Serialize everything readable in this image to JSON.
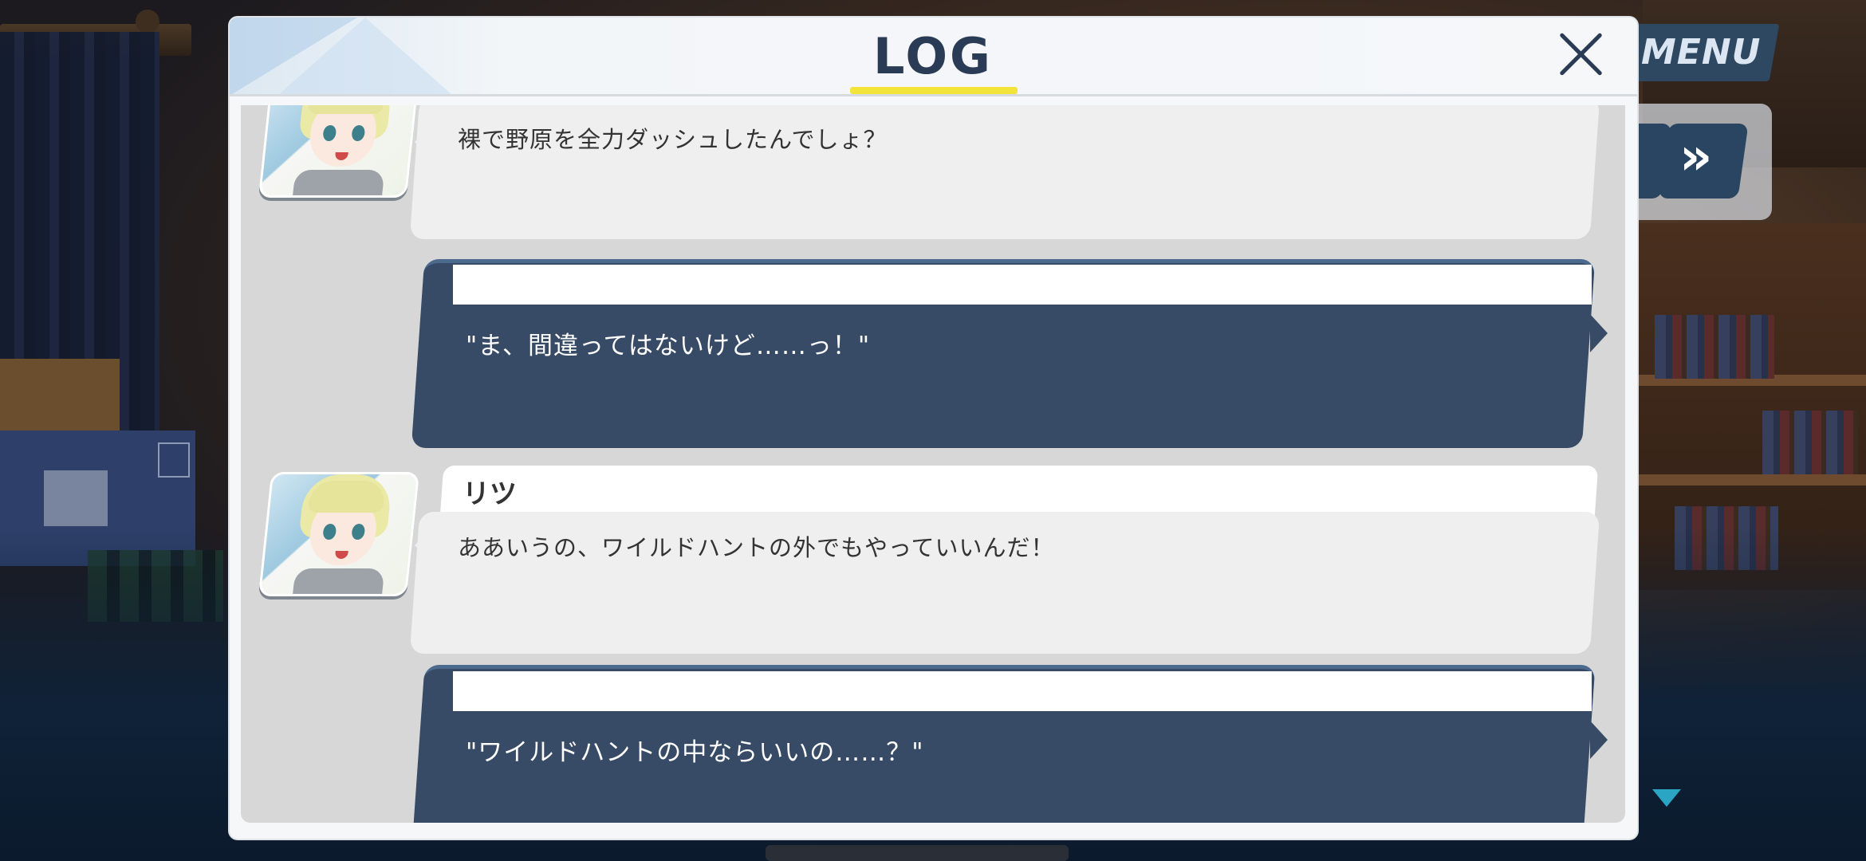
{
  "hud": {
    "menu_label": "MENU",
    "skip_glyph": "»"
  },
  "log": {
    "title": "LOG",
    "entries": [
      {
        "speaker": "",
        "text": "裸で野原を全力ダッシュしたんでしょ？",
        "type": "npc"
      },
      {
        "speaker": "",
        "text": "\"ま、間違ってはないけど……っ！\"",
        "type": "player"
      },
      {
        "speaker": "リツ",
        "text": "ああいうの、ワイルドハントの外でもやっていいんだ！",
        "type": "npc"
      },
      {
        "speaker": "",
        "text": "\"ワイルドハントの中ならいいの……？\"",
        "type": "player"
      }
    ]
  },
  "colors": {
    "accent_yellow": "#f2e43a",
    "player_bubble": "#374b66",
    "npc_bubble": "#efefef",
    "title_text": "#2a3c55"
  }
}
